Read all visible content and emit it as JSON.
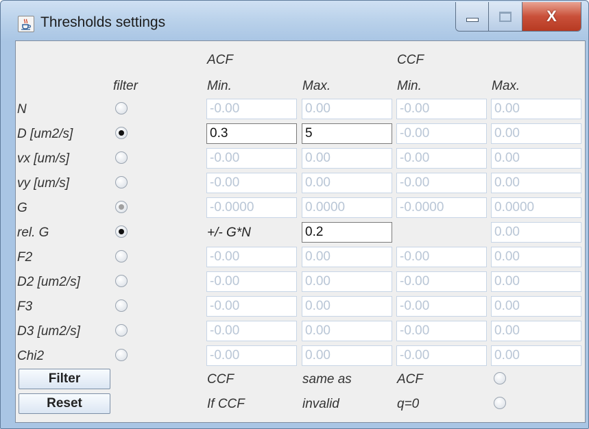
{
  "window": {
    "title": "Thresholds settings",
    "icon": "java-cup-icon",
    "controls": [
      "minimize-icon",
      "maximize-icon",
      "close-icon"
    ],
    "close_glyph": "X"
  },
  "headers": {
    "acf": "ACF",
    "ccf": "CCF",
    "filter": "filter",
    "acf_min": "Min.",
    "acf_max": "Max.",
    "ccf_min": "Min.",
    "ccf_max": "Max."
  },
  "rows": [
    {
      "label": "N",
      "filter": "off",
      "acf_min": "-0.00",
      "acf_max": "0.00",
      "ccf_min": "-0.00",
      "ccf_max": "0.00",
      "active": false
    },
    {
      "label": "D [um2/s]",
      "filter": "on",
      "acf_min": "0.3",
      "acf_max": "5",
      "ccf_min": "-0.00",
      "ccf_max": "0.00",
      "active": true
    },
    {
      "label": "vx [um/s]",
      "filter": "off",
      "acf_min": "-0.00",
      "acf_max": "0.00",
      "ccf_min": "-0.00",
      "ccf_max": "0.00",
      "active": false
    },
    {
      "label": "vy [um/s]",
      "filter": "off",
      "acf_min": "-0.00",
      "acf_max": "0.00",
      "ccf_min": "-0.00",
      "ccf_max": "0.00",
      "active": false
    },
    {
      "label": "G",
      "filter": "disabled-on",
      "acf_min": "-0.0000",
      "acf_max": "0.0000",
      "ccf_min": "-0.0000",
      "ccf_max": "0.0000",
      "active": false
    },
    {
      "label": "rel. G",
      "filter": "on",
      "acf_min_text": "+/- G*N",
      "acf_max": "0.2",
      "ccf_min": "",
      "ccf_max": "0.00",
      "active": true
    },
    {
      "label": "F2",
      "filter": "off",
      "acf_min": "-0.00",
      "acf_max": "0.00",
      "ccf_min": "-0.00",
      "ccf_max": "0.00",
      "active": false
    },
    {
      "label": "D2 [um2/s]",
      "filter": "off",
      "acf_min": "-0.00",
      "acf_max": "0.00",
      "ccf_min": "-0.00",
      "ccf_max": "0.00",
      "active": false
    },
    {
      "label": "F3",
      "filter": "off",
      "acf_min": "-0.00",
      "acf_max": "0.00",
      "ccf_min": "-0.00",
      "ccf_max": "0.00",
      "active": false
    },
    {
      "label": "D3 [um2/s]",
      "filter": "off",
      "acf_min": "-0.00",
      "acf_max": "0.00",
      "ccf_min": "-0.00",
      "ccf_max": "0.00",
      "active": false
    },
    {
      "label": "Chi2",
      "filter": "off",
      "acf_min": "-0.00",
      "acf_max": "0.00",
      "ccf_min": "-0.00",
      "ccf_max": "0.00",
      "active": false
    }
  ],
  "buttons": {
    "filter": "Filter",
    "reset": "Reset"
  },
  "options": [
    {
      "words": [
        "CCF",
        "same as",
        "ACF"
      ],
      "checked": false
    },
    {
      "words": [
        "If CCF",
        "invalid",
        "q=0"
      ],
      "checked": false
    }
  ]
}
